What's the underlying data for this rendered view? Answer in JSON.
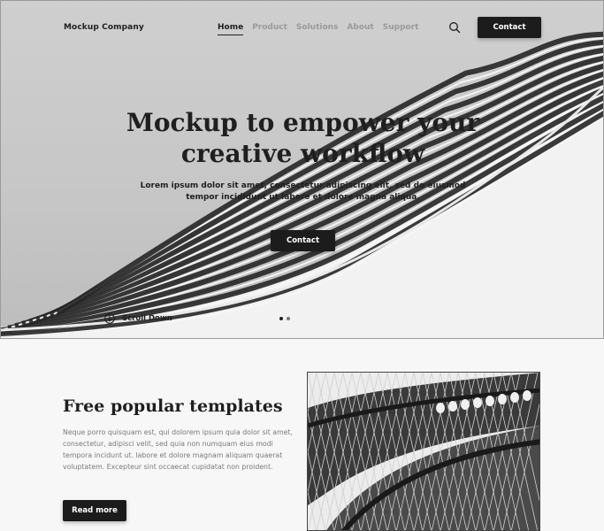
{
  "nav": {
    "logo": "Mockup Company",
    "items": [
      {
        "label": "Home",
        "active": true
      },
      {
        "label": "Product",
        "active": false
      },
      {
        "label": "Solutions",
        "active": false
      },
      {
        "label": "About",
        "active": false
      },
      {
        "label": "Support",
        "active": false
      }
    ],
    "search_icon": "search-icon",
    "contact_label": "Contact"
  },
  "hero": {
    "title_line1": "Mockup to empower your",
    "title_line2": "creative workflow",
    "subtitle": "Lorem ipsum dolor sit amet, consectetur adipiscing elit, sed do eiusmod tempor incididunt ut labore et dolore magna aliqua.",
    "cta_label": "Contact",
    "scroll_label": "Scroll Down",
    "scroll_icon": "arrow-down-circle-icon",
    "slide_count": 2,
    "active_slide": 0
  },
  "templates": {
    "title": "Free popular templates",
    "body": "Neque porro quisquam est, qui dolorem ipsum quia dolor sit amet, consectetur, adipisci velit, sed quia non numquam eius modi tempora incidunt ut. labore et dolore magnam aliquam quaerat voluptatem. Excepteur sint occaecat cupidatat non proident.",
    "button_label": "Read more"
  },
  "colors": {
    "dark": "#1c1c1c",
    "muted_text": "#7a7a7a",
    "nav_inactive": "#9a9a9a",
    "hero_bg": "#c9c9c9",
    "page_bg": "#f7f7f7"
  }
}
